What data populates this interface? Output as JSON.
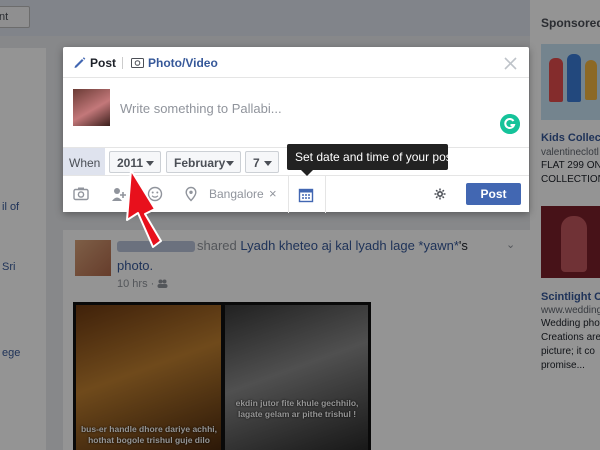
{
  "background": {
    "top_dropdown": "nt",
    "left_col": [
      "il of",
      "Sri",
      "ege"
    ],
    "sponsored": "Sponsored",
    "ad1": {
      "title": "Kids Collecti",
      "url": "valentineclotl",
      "line1": "FLAT 299 ON",
      "line2": "COLLECTION"
    },
    "ad2": {
      "title": "Scintlight Cr",
      "url": "www.wedding",
      "lines": [
        "Wedding photo",
        "Creations are",
        "picture; it co",
        "promise..."
      ]
    },
    "feed": {
      "shared": "shared",
      "post_link": "Lyadh kheteo aj kal lyadh lage *yawn*",
      "post_link_suffix": "'s",
      "post_link_line2": "photo.",
      "time": "10 hrs",
      "meme_left": "bus-er handle dhore dariye achhi, hothat bogole trishul guje dilo",
      "meme_right": "ekdin jutor fite khule gechhilo, lagate gelam ar pithe trishul !"
    }
  },
  "composer": {
    "tabs": {
      "post": "Post",
      "photo_video": "Photo/Video"
    },
    "input_placeholder": "Write something to Pallabi...",
    "schedule": {
      "when_label": "When",
      "year": "2011",
      "month": "February",
      "day": "7"
    },
    "tooltip": "Set date and time of your post",
    "location": "Bangalore",
    "post_button": "Post"
  },
  "colors": {
    "brand_blue": "#4267b2",
    "link_blue": "#365899",
    "grammarly_green": "#15c39a",
    "annotation_red": "#e8101c"
  }
}
